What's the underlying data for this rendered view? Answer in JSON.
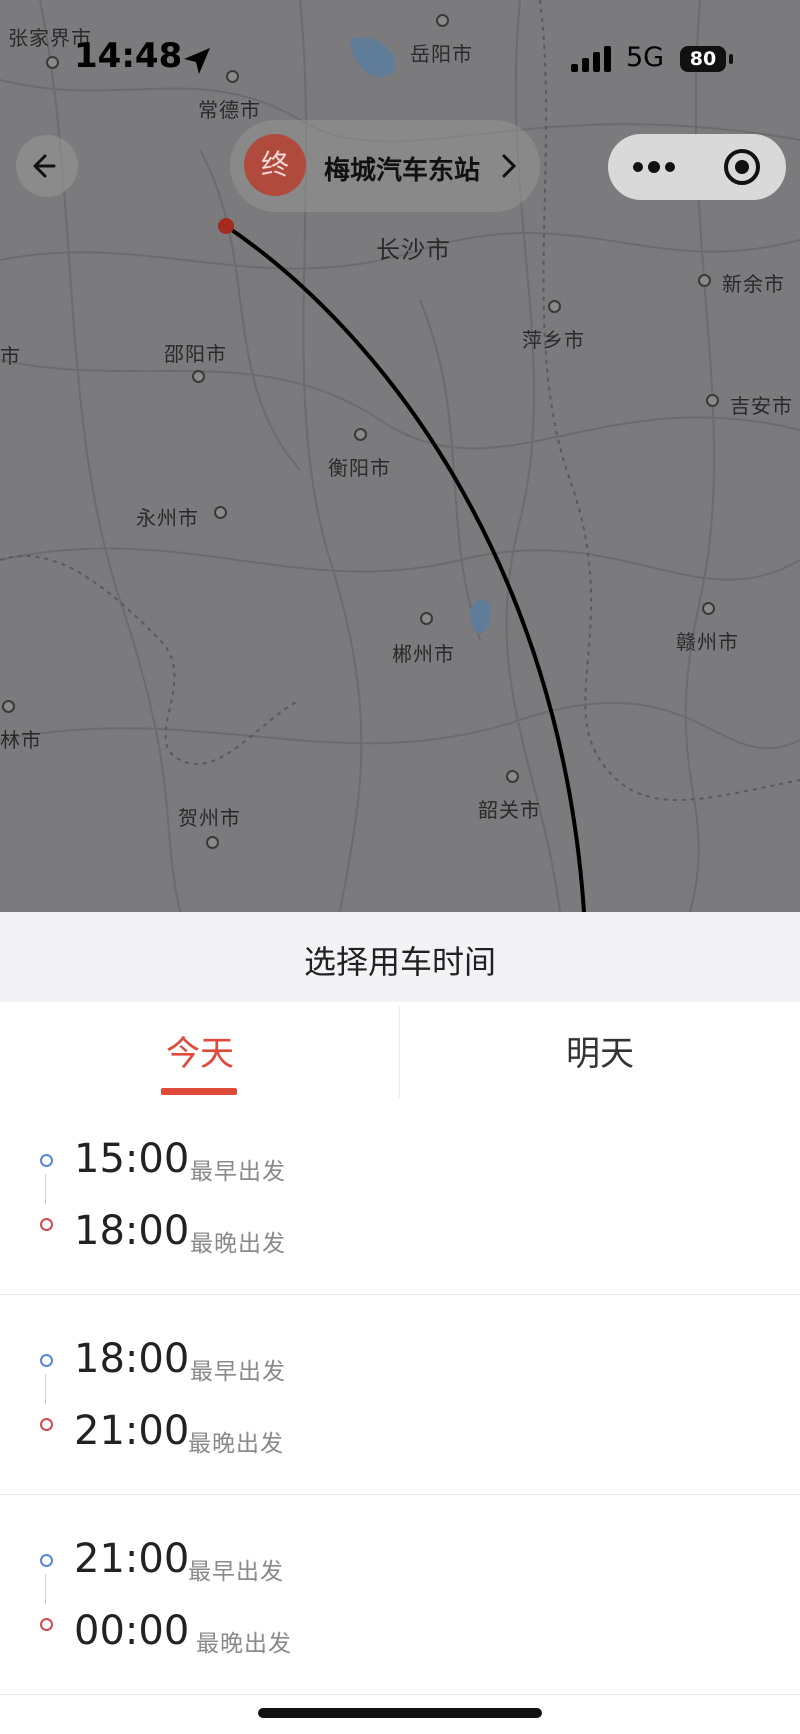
{
  "status_bar": {
    "time": "14:48",
    "network": "5G",
    "battery": "80"
  },
  "map": {
    "cities": [
      "张家界市",
      "岳阳市",
      "常德市",
      "长沙市",
      "新余市",
      "萍乡市",
      "邵阳市",
      "吉安市",
      "衡阳市",
      "永州市",
      "赣州市",
      "郴州市",
      "林市",
      "韶关市",
      "贺州市",
      "市"
    ]
  },
  "header": {
    "back_icon": "back-arrow-icon",
    "dest_badge": "终",
    "dest_name": "梅城汽车东站"
  },
  "capsule": {
    "menu_icon": "more-dots-icon",
    "close_icon": "target-circle-icon"
  },
  "sheet": {
    "title": "选择用车时间",
    "tabs": [
      {
        "label": "今天"
      },
      {
        "label": "明天"
      }
    ],
    "active_tab_color": "#e04a3b",
    "slots": [
      {
        "start": "15:00",
        "start_label": "最早出发",
        "end": "18:00",
        "end_label": "最晚出发"
      },
      {
        "start": "18:00",
        "start_label": "最早出发",
        "end": "21:00",
        "end_label": "最晚出发"
      },
      {
        "start": "21:00",
        "start_label": "最早出发",
        "end": "00:00",
        "end_label": "最晚出发"
      }
    ]
  }
}
